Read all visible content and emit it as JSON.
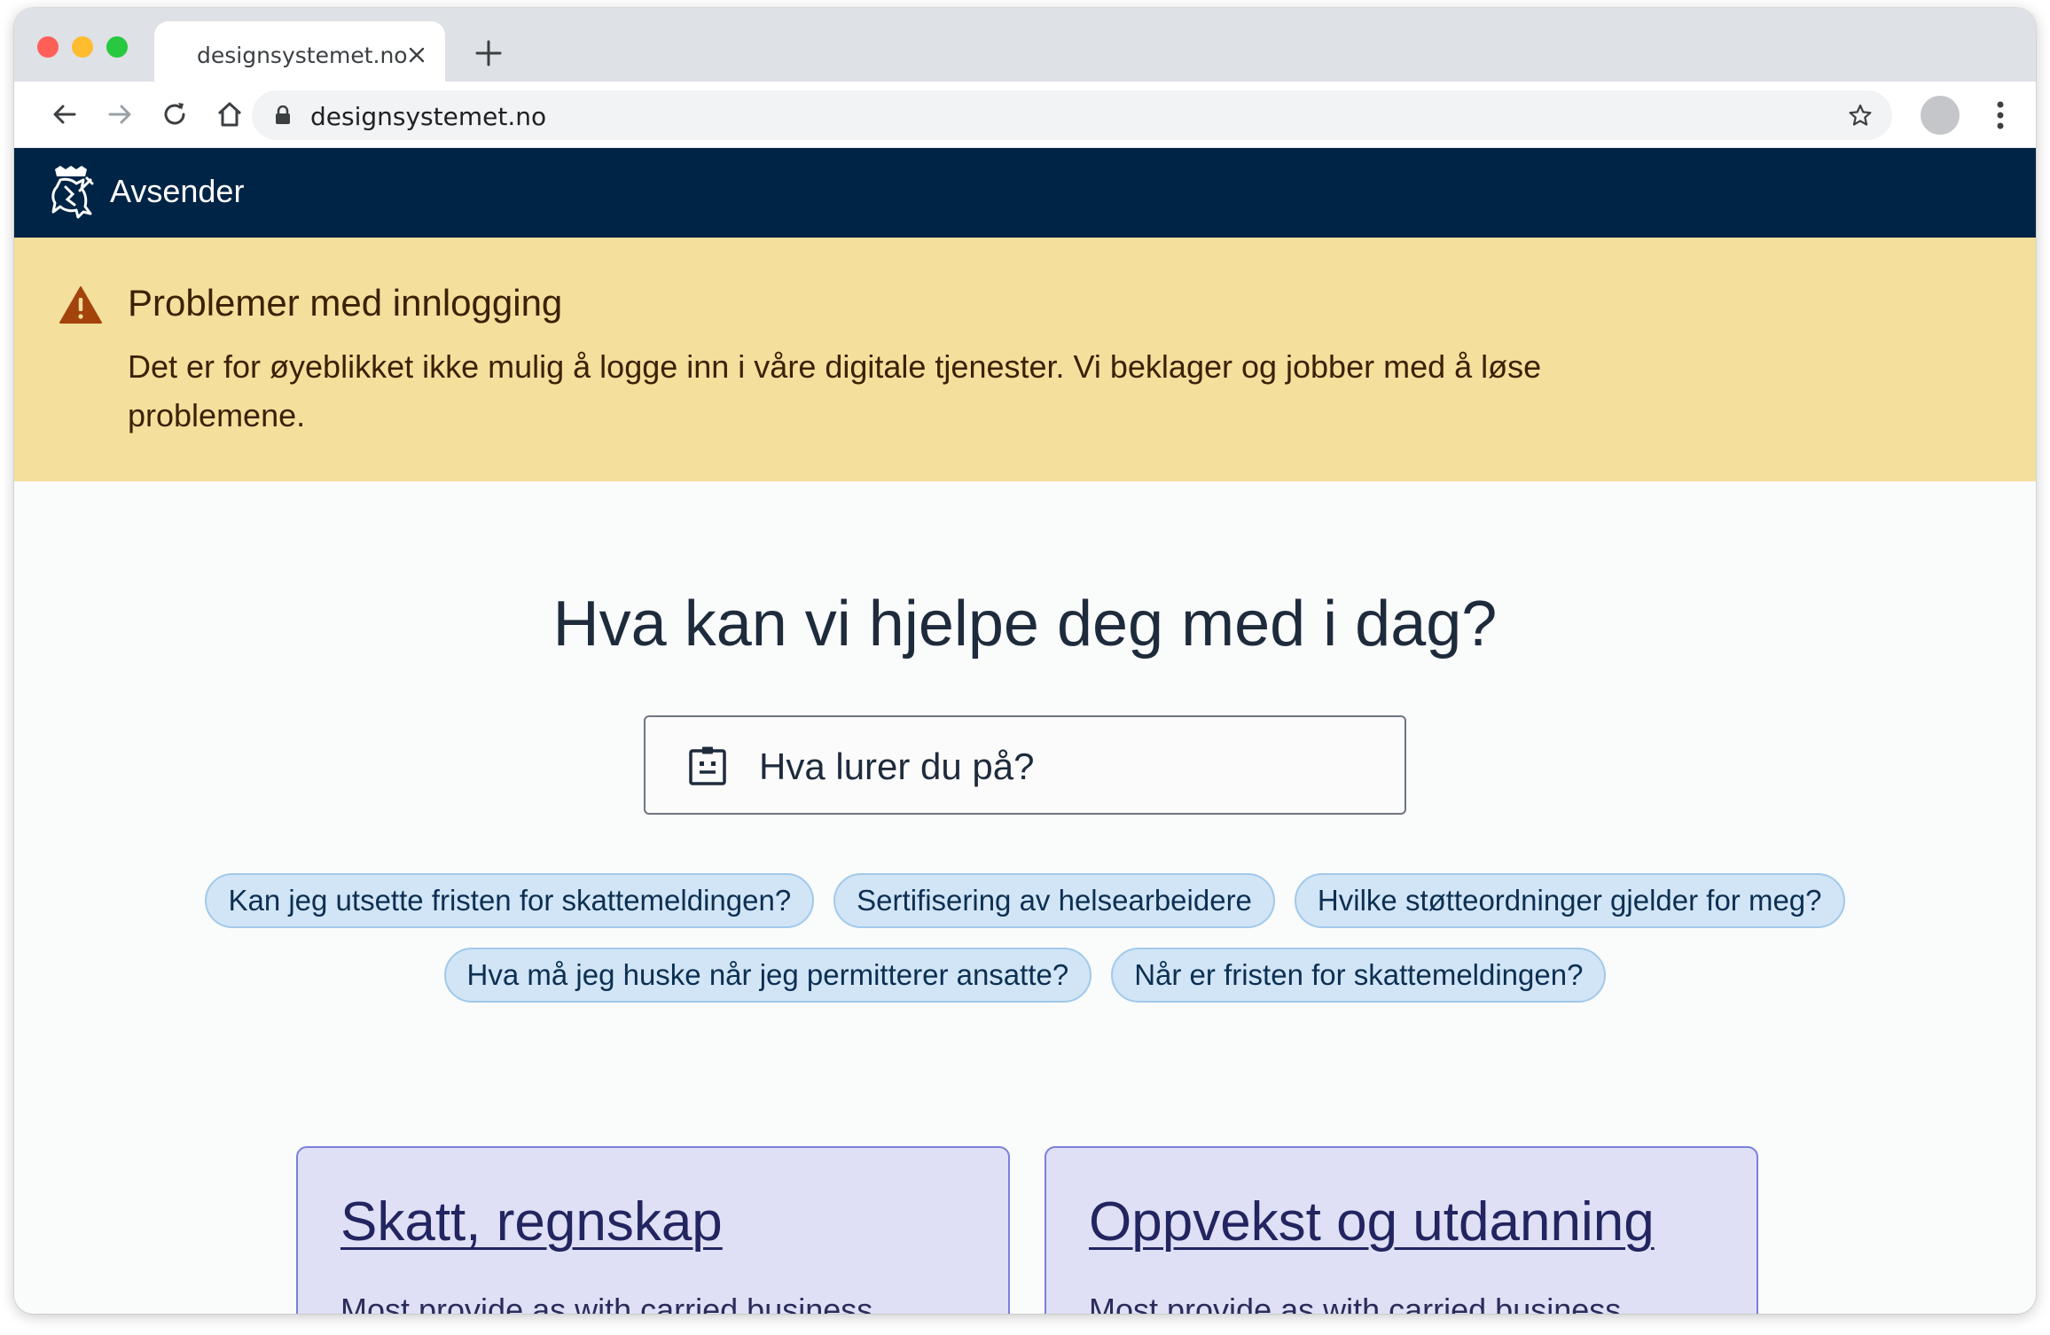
{
  "browser": {
    "tab_title": "designsystemet.no",
    "url": "designsystemet.no"
  },
  "header": {
    "sender": "Avsender"
  },
  "alert": {
    "title": "Problemer med innlogging",
    "body": "Det er for øyeblikket ikke mulig å logge inn i våre digitale tjenester. Vi beklager og jobber med å løse problemene."
  },
  "main": {
    "heading": "Hva kan vi hjelpe deg med i dag?",
    "search_label": "Hva lurer du på?",
    "suggestions_row1": [
      "Kan jeg utsette fristen for skattemeldingen?",
      "Sertifisering av helsearbeidere",
      "Hvilke støtteordninger gjelder for meg?"
    ],
    "suggestions_row2": [
      "Hva må jeg huske når jeg permitterer ansatte?",
      "Når er fristen for skattemeldingen?"
    ],
    "cards": [
      {
        "title": "Skatt, regnskap",
        "body": "Most provide as with carried business"
      },
      {
        "title": "Oppvekst og utdanning",
        "body": "Most provide as with carried business"
      }
    ]
  },
  "colors": {
    "header_bg": "#002445",
    "alert_bg": "#f4df9d",
    "chip_bg": "#d1e5f6",
    "card_bg": "#dfe0f6"
  }
}
